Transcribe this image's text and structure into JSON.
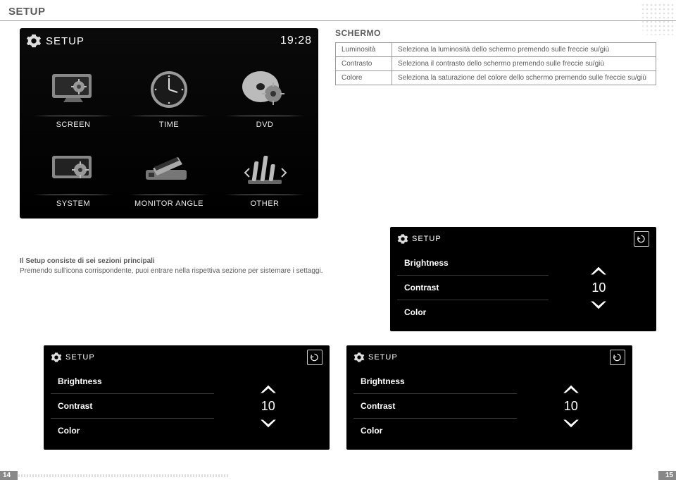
{
  "page": {
    "title": "SETUP",
    "left_no": "14",
    "right_no": "15"
  },
  "device": {
    "title": "SETUP",
    "clock": "19:28",
    "tiles": [
      {
        "label": "SCREEN"
      },
      {
        "label": "TIME"
      },
      {
        "label": "DVD"
      },
      {
        "label": "SYSTEM"
      },
      {
        "label": "MONITOR ANGLE"
      },
      {
        "label": "OTHER"
      }
    ]
  },
  "schermo": {
    "heading": "SCHERMO",
    "rows": [
      {
        "k": "Luminosità",
        "v": "Seleziona la luminosità dello schermo premendo sulle freccie su/giù"
      },
      {
        "k": "Contrasto",
        "v": "Seleziona il contrasto dello schermo  premendo sulle freccie su/giù"
      },
      {
        "k": "Colore",
        "v": "Seleziona la saturazione del colore dello schermo  premendo sulle freccie su/giù"
      }
    ]
  },
  "caption": {
    "bold": "Il Setup consiste di sei sezioni principali",
    "rest": "Premendo sull'icona corrispondente, puoi entrare nella rispettiva sezione per sistemare i settaggi."
  },
  "panel": {
    "title": "SETUP",
    "items": [
      "Brightness",
      "Contrast",
      "Color"
    ],
    "value": "10"
  }
}
